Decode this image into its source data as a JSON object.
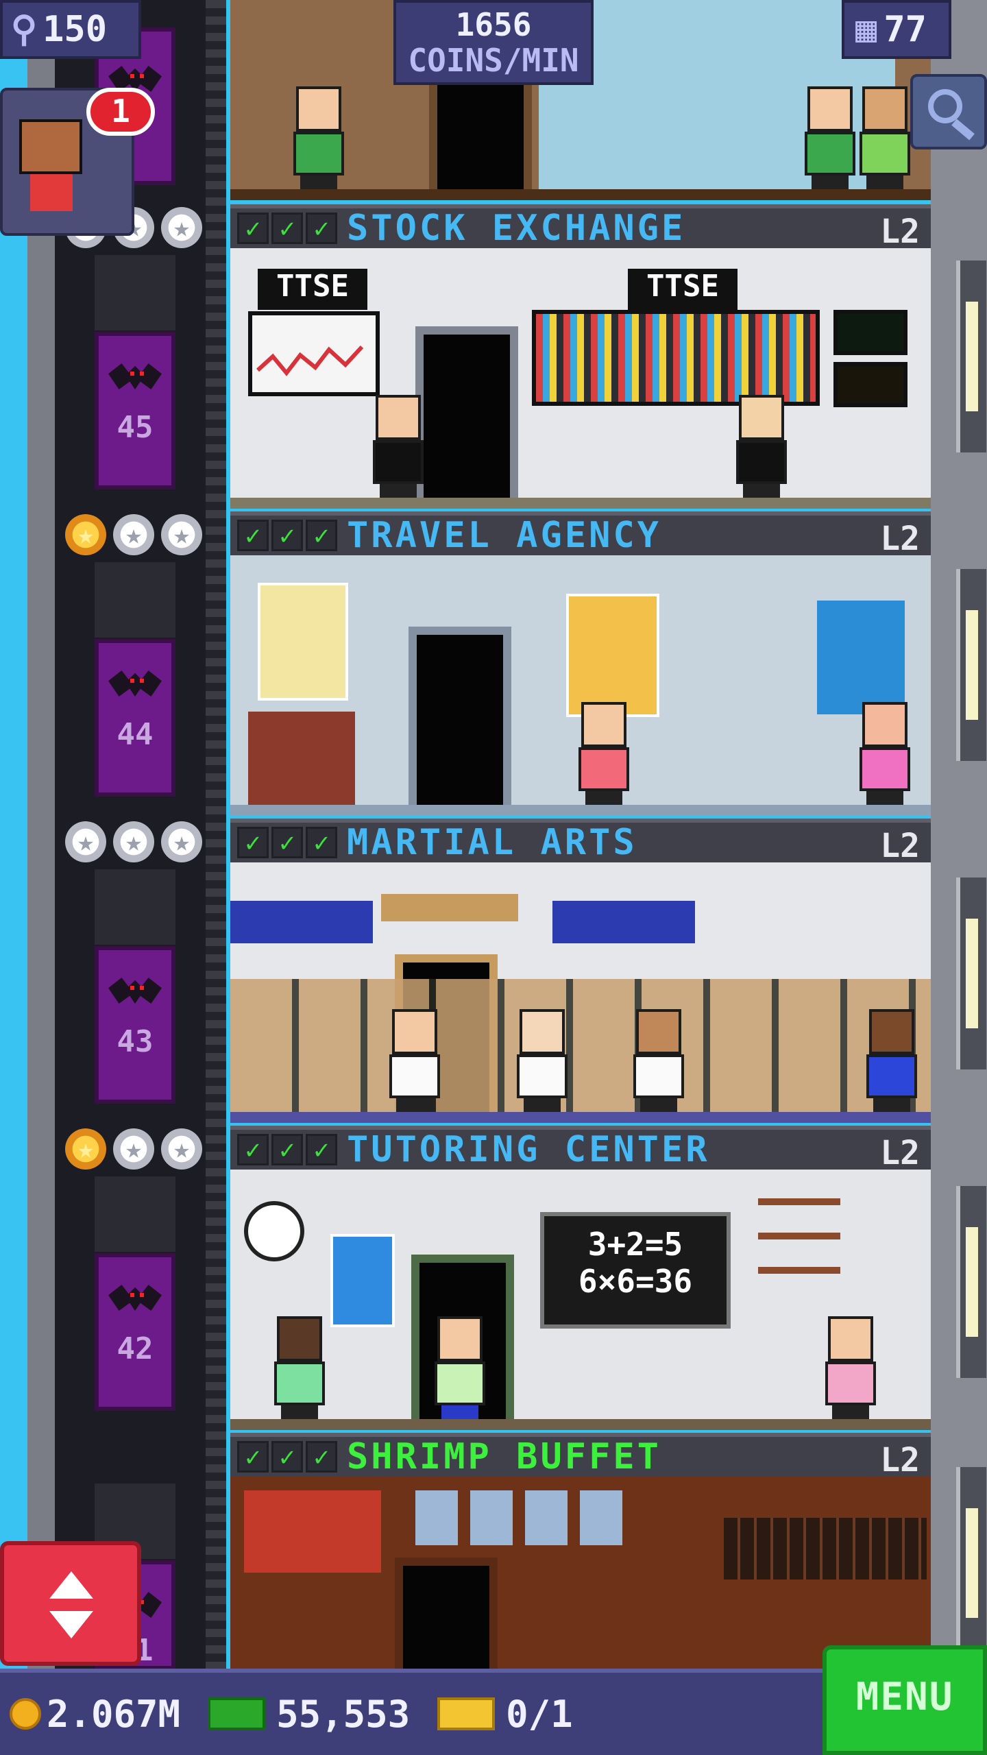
{
  "hud": {
    "population": "150",
    "coins_per_min": "1656",
    "coins_per_min_unit": "COINS/MIN",
    "floors": "77"
  },
  "visitor": {
    "badge_count": "1"
  },
  "floors": [
    {
      "name": "STOCK EXCHANGE",
      "level": "L2",
      "elevator_number": "45",
      "stars": [
        "silver",
        "silver",
        "silver"
      ],
      "name_color": "blue",
      "signs": [
        "TTSE",
        "TTSE"
      ]
    },
    {
      "name": "TRAVEL AGENCY",
      "level": "L2",
      "elevator_number": "44",
      "stars": [
        "gold",
        "silver",
        "silver"
      ],
      "name_color": "blue"
    },
    {
      "name": "MARTIAL ARTS",
      "level": "L2",
      "elevator_number": "43",
      "stars": [
        "silver",
        "silver",
        "silver"
      ],
      "name_color": "blue"
    },
    {
      "name": "TUTORING CENTER",
      "level": "L2",
      "elevator_number": "42",
      "stars": [
        "gold",
        "silver",
        "silver"
      ],
      "name_color": "blue",
      "board_lines": [
        "3+2=5",
        "6×6=36"
      ]
    },
    {
      "name": "SHRIMP BUFFET",
      "level": "L2",
      "elevator_number": "41",
      "stars": [],
      "name_color": "green"
    }
  ],
  "bottom": {
    "coins": "2.067M",
    "bux": "55,553",
    "tickets": "0/1",
    "menu_label": "MENU"
  },
  "colors": {
    "sky": "#39c3f3",
    "elevator": "#6d1a8a",
    "floor_name_blue": "#46b8f4",
    "floor_name_green": "#3ef03e",
    "menu_green": "#23c433",
    "elevator_button_red": "#e83448"
  },
  "icons": [
    "population-icon",
    "building-icon",
    "search-icon",
    "coin-icon",
    "bux-icon",
    "ticket-icon",
    "elevator-arrows-icon"
  ]
}
